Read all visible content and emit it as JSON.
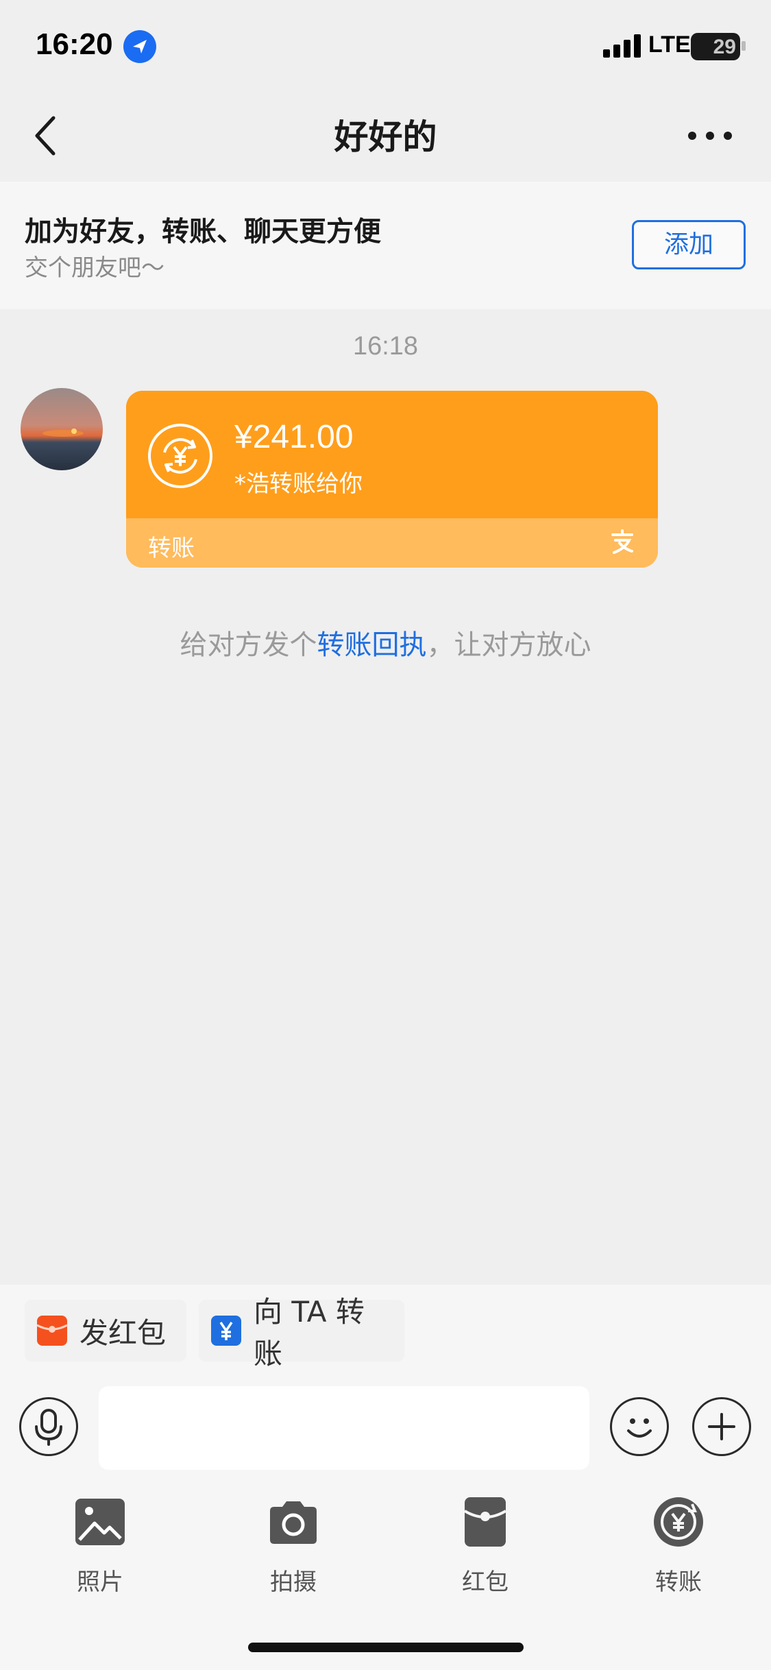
{
  "status_bar": {
    "time": "16:20",
    "network": "LTE",
    "battery": "29"
  },
  "nav": {
    "title": "好好的"
  },
  "banner": {
    "title": "加为好友，转账、聊天更方便",
    "subtitle": "交个朋友吧～",
    "add_label": "添加"
  },
  "chat": {
    "timestamp": "16:18",
    "transfer": {
      "amount": "¥241.00",
      "description": "*浩转账给你",
      "label": "转账"
    },
    "hint": {
      "prefix": "给对方发个",
      "link": "转账回执",
      "suffix": "，让对方放心"
    }
  },
  "quick_actions": [
    {
      "label": "发红包",
      "icon": "red-envelope-icon",
      "color": "#f4511e"
    },
    {
      "label": "向 TA 转账",
      "icon": "transfer-icon",
      "color": "#1f6fe0"
    }
  ],
  "input": {
    "placeholder": ""
  },
  "toolbar": [
    {
      "label": "照片",
      "icon": "photo-icon"
    },
    {
      "label": "拍摄",
      "icon": "camera-icon"
    },
    {
      "label": "红包",
      "icon": "red-envelope-icon"
    },
    {
      "label": "转账",
      "icon": "transfer-icon"
    }
  ],
  "colors": {
    "accent": "#1f6fe0",
    "card": "#ff9e1b",
    "card_bottom": "#ffbb5c"
  }
}
